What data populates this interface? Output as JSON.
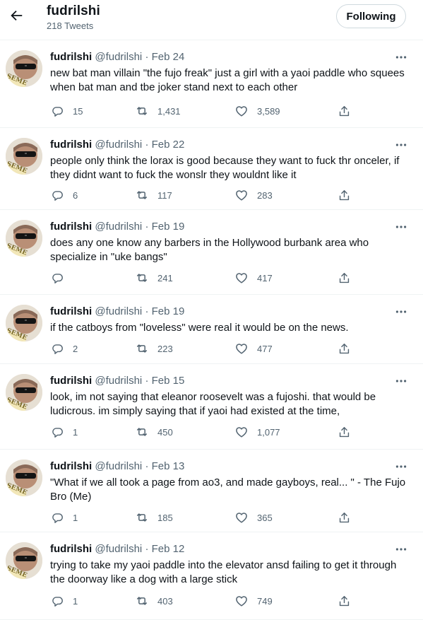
{
  "header": {
    "title": "fudrilshi",
    "tweet_count": "218 Tweets",
    "follow_label": "Following"
  },
  "tweets": [
    {
      "name": "fudrilshi",
      "handle": "@fudrilshi",
      "dot": "·",
      "date": "Feb 24",
      "text": "new bat man villain \"the fujo freak\" just a girl with a yaoi paddle who squees when bat man and tbe joker stand next to each other",
      "replies": "15",
      "retweets": "1,431",
      "likes": "3,589"
    },
    {
      "name": "fudrilshi",
      "handle": "@fudrilshi",
      "dot": "·",
      "date": "Feb 22",
      "text": "people only think the lorax is good because they want to fuck thr onceler, if they didnt want to fuck the wonslr they wouldnt like it",
      "replies": "6",
      "retweets": "117",
      "likes": "283"
    },
    {
      "name": "fudrilshi",
      "handle": "@fudrilshi",
      "dot": "·",
      "date": "Feb 19",
      "text": "does any one know any barbers in the Hollywood burbank area who specialize in \"uke bangs\"",
      "replies": "",
      "retweets": "241",
      "likes": "417"
    },
    {
      "name": "fudrilshi",
      "handle": "@fudrilshi",
      "dot": "·",
      "date": "Feb 19",
      "text": "if the catboys from \"loveless\" were real it would be on the news.",
      "replies": "2",
      "retweets": "223",
      "likes": "477"
    },
    {
      "name": "fudrilshi",
      "handle": "@fudrilshi",
      "dot": "·",
      "date": "Feb 15",
      "text": "look, im not saying that eleanor roosevelt was a fujoshi. that would be ludicrous. im simply saying that if yaoi had existed at the time,",
      "replies": "1",
      "retweets": "450",
      "likes": "1,077"
    },
    {
      "name": "fudrilshi",
      "handle": "@fudrilshi",
      "dot": "·",
      "date": "Feb 13",
      "text": "\"What if we all took a page from ao3, and made gayboys, real... \" - The Fujo Bro (Me)",
      "replies": "1",
      "retweets": "185",
      "likes": "365"
    },
    {
      "name": "fudrilshi",
      "handle": "@fudrilshi",
      "dot": "·",
      "date": "Feb 12",
      "text": "trying to take my yaoi paddle into the elevator ansd failing to get it through the doorway like a dog with a large stick",
      "replies": "1",
      "retweets": "403",
      "likes": "749"
    }
  ],
  "icons": {
    "back": "arrow-left-icon",
    "more": "more-icon",
    "reply": "reply-icon",
    "retweet": "retweet-icon",
    "like": "heart-icon",
    "share": "share-icon"
  },
  "colors": {
    "text": "#0f1419",
    "secondary": "#536471",
    "divider": "#eff3f4",
    "button_border": "#cfd9de"
  }
}
